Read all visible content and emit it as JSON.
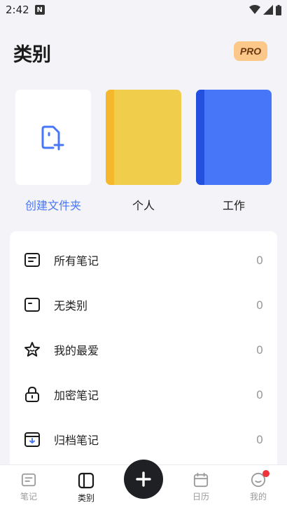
{
  "status_bar": {
    "time": "2:42",
    "notification_icon": "N"
  },
  "header": {
    "title": "类别",
    "pro_badge": "PRO"
  },
  "folders": [
    {
      "label": "创建文件夹",
      "type": "create",
      "icon": "create-folder-icon"
    },
    {
      "label": "个人",
      "type": "notebook",
      "color": "#f0cd4b"
    },
    {
      "label": "工作",
      "type": "notebook",
      "color": "#4876f9"
    }
  ],
  "categories": [
    {
      "label": "所有笔记",
      "count": "0",
      "icon": "notes-icon"
    },
    {
      "label": "无类别",
      "count": "0",
      "icon": "uncategorized-icon"
    },
    {
      "label": "我的最爱",
      "count": "0",
      "icon": "star-icon"
    },
    {
      "label": "加密笔记",
      "count": "0",
      "icon": "lock-icon"
    },
    {
      "label": "归档笔记",
      "count": "0",
      "icon": "archive-icon"
    }
  ],
  "bottom_nav": {
    "notes": "笔记",
    "categories": "类别",
    "calendar": "日历",
    "mine": "我的"
  },
  "colors": {
    "accent": "#4876f9",
    "pro": "#fbc889",
    "yellow": "#f0cd4b",
    "blue": "#4876f9"
  }
}
